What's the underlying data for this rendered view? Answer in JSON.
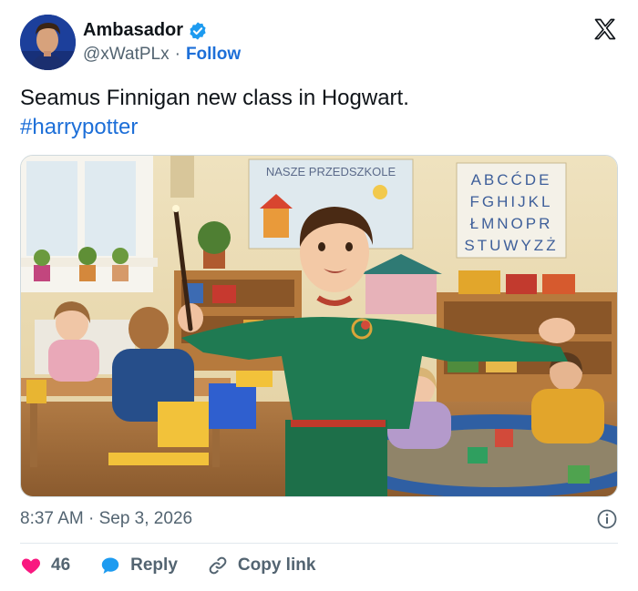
{
  "author": {
    "display_name": "Ambasador",
    "handle": "@xWatPLx",
    "separator": "·",
    "follow_label": "Follow"
  },
  "tweet": {
    "text": "Seamus Finnigan new class in Hogwart.",
    "hashtag": "#harrypotter"
  },
  "image": {
    "banner_text": "NASZE PRZEDSZKOLE",
    "alphabet_rows": [
      "ABCĆDE",
      "FGHIJKL",
      "ŁMNOPR",
      "STUWYZŻ"
    ]
  },
  "meta": {
    "timestamp": "8:37 AM · Sep 3, 2026"
  },
  "actions": {
    "like_count": "46",
    "reply_label": "Reply",
    "copy_link_label": "Copy link"
  },
  "colors": {
    "accent": "#1d6fd8",
    "like": "#f91880",
    "reply": "#1d9bf0",
    "text_secondary": "#536471"
  },
  "icons": [
    "verified-badge-icon",
    "x-logo-icon",
    "info-icon",
    "heart-icon",
    "reply-bubble-icon",
    "link-icon"
  ]
}
